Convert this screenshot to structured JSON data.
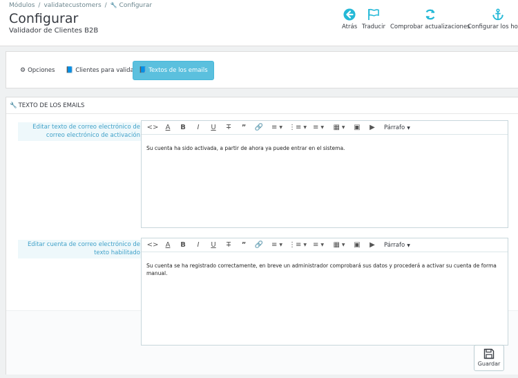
{
  "breadcrumb": {
    "items": [
      "Módulos",
      "validatecustomers",
      "Configurar"
    ],
    "separator": "/"
  },
  "page": {
    "title": "Configurar",
    "subtitle": "Validador de Clientes B2B"
  },
  "toolbar": {
    "back_label": "Atrás",
    "translate_label": "Traducir",
    "check_updates_label": "Comprobar actualizaciones",
    "hooks_label": "Configurar los hooks"
  },
  "tabs": [
    {
      "label": "Opciones",
      "icon": "gears-icon"
    },
    {
      "label": "Clientes para validar",
      "icon": "book-icon"
    },
    {
      "label": "Textos de los emails",
      "icon": "book-icon",
      "active": true
    }
  ],
  "section": {
    "heading": "TEXTO DE LOS EMAILS"
  },
  "fields": [
    {
      "label": "Editar texto de correo electrónico de correo electrónico de activación",
      "content": "Su cuenta ha sido activada, a partir de ahora ya puede entrar en el sistema."
    },
    {
      "label": "Editar cuenta de correo electrónico de texto habilitado",
      "content": "Su cuenta se ha registrado correctamente, en breve un administrador comprobará sus datos y procederá a activar su cuenta de forma manual."
    }
  ],
  "editor": {
    "format_label": "Párrafo"
  },
  "save_button": {
    "label": "Guardar"
  },
  "colors": {
    "accent": "#25b9d7",
    "active_tab": "#5bc0de",
    "label_text": "#3ea0c8"
  }
}
